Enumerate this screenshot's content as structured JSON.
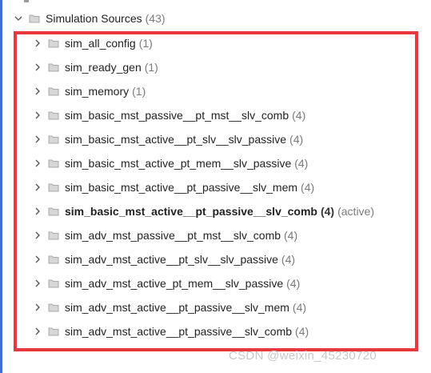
{
  "tree": {
    "root": {
      "label": "Simulation Sources",
      "count": "(43)"
    },
    "items": [
      {
        "label": "sim_all_config",
        "count": "(1)"
      },
      {
        "label": "sim_ready_gen",
        "count": "(1)"
      },
      {
        "label": "sim_memory",
        "count": "(1)"
      },
      {
        "label": "sim_basic_mst_passive__pt_mst__slv_comb",
        "count": "(4)"
      },
      {
        "label": "sim_basic_mst_active__pt_slv__slv_passive",
        "count": "(4)"
      },
      {
        "label": "sim_basic_mst_active_pt_mem__slv_passive",
        "count": "(4)"
      },
      {
        "label": "sim_basic_mst_active__pt_passive__slv_mem",
        "count": "(4)"
      },
      {
        "label": "sim_basic_mst_active__pt_passive__slv_comb",
        "count": "(4)",
        "tag": "(active)"
      },
      {
        "label": "sim_adv_mst_passive__pt_mst__slv_comb",
        "count": "(4)"
      },
      {
        "label": "sim_adv_mst_active__pt_slv__slv_passive",
        "count": "(4)"
      },
      {
        "label": "sim_adv_mst_active_pt_mem__slv_passive",
        "count": "(4)"
      },
      {
        "label": "sim_adv_mst_active__pt_passive__slv_mem",
        "count": "(4)"
      },
      {
        "label": "sim_adv_mst_active__pt_passive__slv_comb",
        "count": "(4)"
      }
    ]
  },
  "watermark": "CSDN @weixin_45230720",
  "colors": {
    "highlight": "#e8383d",
    "accent": "#3f6fd8"
  }
}
